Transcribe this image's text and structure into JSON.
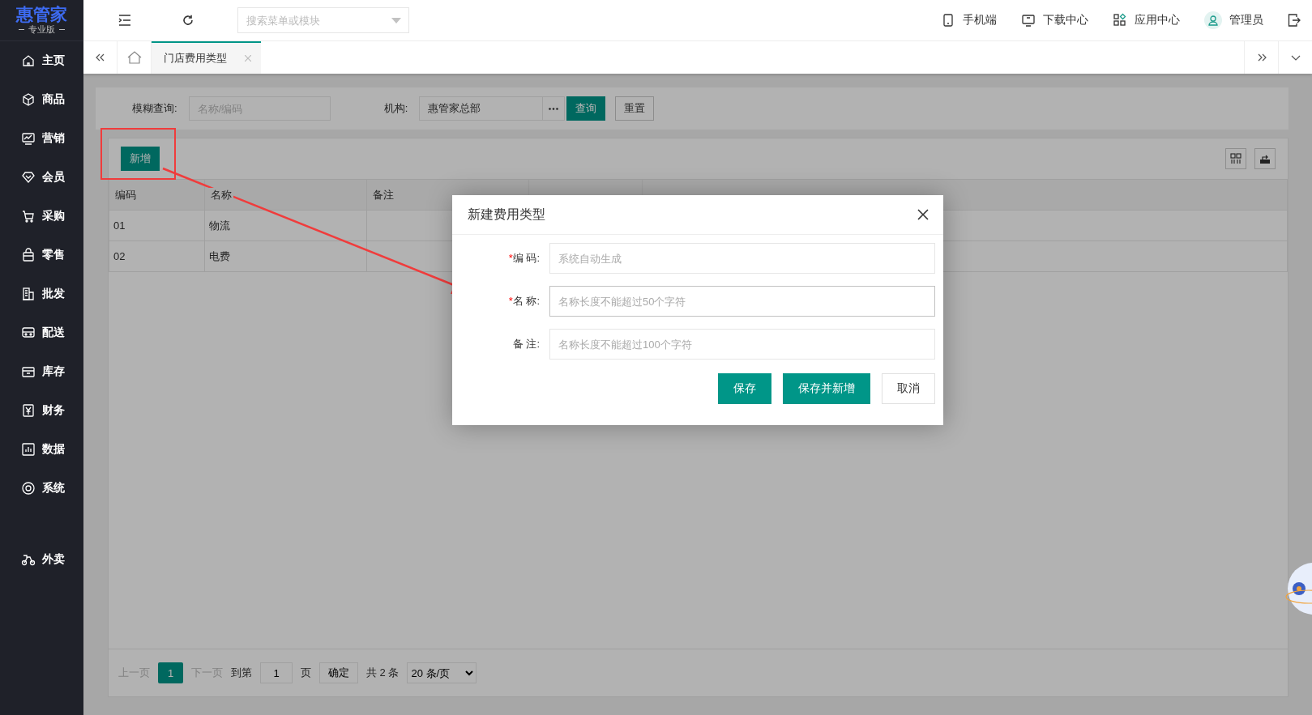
{
  "logo": {
    "name": "惠管家",
    "edition": "专业版"
  },
  "sidebar": {
    "items": [
      {
        "label": "主页"
      },
      {
        "label": "商品"
      },
      {
        "label": "营销"
      },
      {
        "label": "会员"
      },
      {
        "label": "采购"
      },
      {
        "label": "零售"
      },
      {
        "label": "批发"
      },
      {
        "label": "配送"
      },
      {
        "label": "库存"
      },
      {
        "label": "财务"
      },
      {
        "label": "数据"
      },
      {
        "label": "系统"
      }
    ],
    "extra_items": [
      {
        "label": "外卖"
      }
    ]
  },
  "topbar": {
    "search": {
      "placeholder": "搜索菜单或模块"
    },
    "links": [
      {
        "label": "手机端"
      },
      {
        "label": "下载中心"
      },
      {
        "label": "应用中心"
      },
      {
        "label": "管理员"
      }
    ]
  },
  "tabs": [
    {
      "label": "门店费用类型",
      "selected": true
    }
  ],
  "filter": {
    "keyword_label": "模糊查询:",
    "keyword_placeholder": "名称/编码",
    "org_label": "机构:",
    "org_value": "惠管家总部",
    "buttons": [
      {
        "label": "查询",
        "kind": "primary"
      },
      {
        "label": "重置",
        "kind": "default"
      }
    ]
  },
  "toolbar": {
    "add_button": "新增"
  },
  "table": {
    "columns": [
      "编码",
      "名称",
      "备注"
    ],
    "rows": [
      {
        "code": "01",
        "name": "物流"
      },
      {
        "code": "02",
        "name": "电费"
      }
    ]
  },
  "pagination": {
    "prev": "上一页",
    "pages": [
      {
        "label": "1",
        "selected": true
      }
    ],
    "next": "下一页",
    "goto_label": "到第",
    "goto_value": "1",
    "page_unit": "页",
    "confirm": "确定",
    "total": "共 2 条",
    "page_size": "20 条/页",
    "prev_disabled": true,
    "next_disabled": true
  },
  "dialog": {
    "title": "新建费用类型",
    "fields": [
      {
        "label": "编 码:",
        "required_mark": "*",
        "placeholder": "系统自动生成",
        "focused": false
      },
      {
        "label": "名 称:",
        "required_mark": "*",
        "placeholder": "名称长度不能超过50个字符",
        "focused": true
      },
      {
        "label": "备 注:",
        "placeholder": "名称长度不能超过100个字符",
        "focused": false
      }
    ],
    "buttons": [
      {
        "label": "保存",
        "kind": "primary"
      },
      {
        "label": "保存并新增",
        "kind": "primary"
      },
      {
        "label": "取消",
        "kind": "default"
      }
    ]
  }
}
